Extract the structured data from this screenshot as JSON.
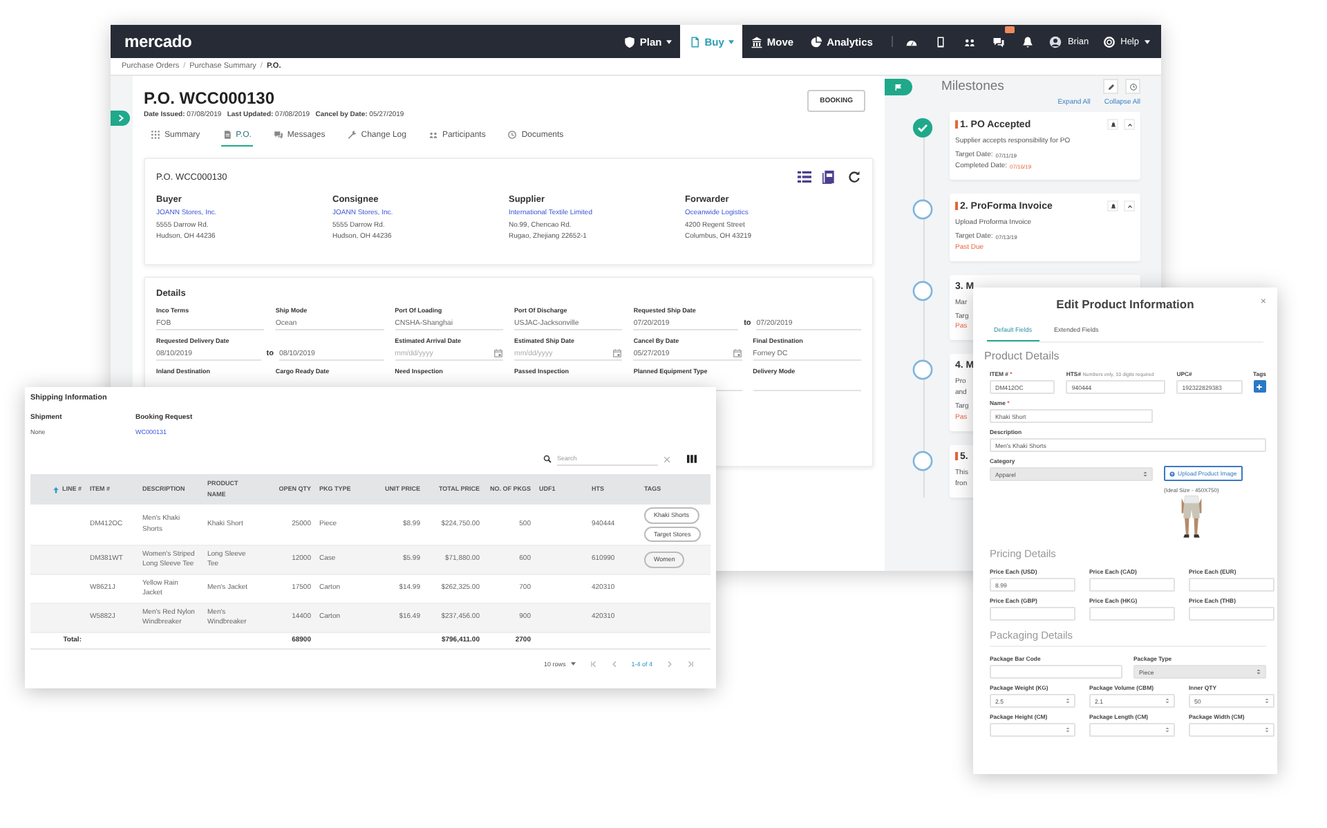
{
  "nav": {
    "logo": "mercado",
    "menus": [
      {
        "label": "Plan",
        "dropdown": true,
        "selected": false
      },
      {
        "label": "Buy",
        "dropdown": true,
        "selected": true
      },
      {
        "label": "Move",
        "dropdown": false,
        "selected": false
      },
      {
        "label": "Analytics",
        "dropdown": false,
        "selected": false
      }
    ],
    "tools": [
      {
        "badge": false
      },
      {
        "badge": false
      },
      {
        "badge": false
      },
      {
        "badge": true
      },
      {
        "badge": false
      }
    ],
    "user": "Brian",
    "help": {
      "label": "Help",
      "dropdown": true
    }
  },
  "breadcrumb": {
    "items": [
      "Purchase Orders",
      "Purchase Summary",
      "P.O."
    ],
    "separator": "/"
  },
  "header": {
    "title": "P.O. WCC000130",
    "meta": "**Date Issued:** 07/08/2019   **Last Updated:** 07/08/2019   **Cancel by Date:** 05/27/2019",
    "button": "BOOKING"
  },
  "tabs": [
    {
      "label": "Summary",
      "selected": false
    },
    {
      "label": "P.O.",
      "selected": true
    },
    {
      "label": "Messages",
      "selected": false
    },
    {
      "label": "Change Log",
      "selected": false
    },
    {
      "label": "Participants",
      "selected": false
    },
    {
      "label": "Documents",
      "selected": false
    }
  ],
  "po_card": {
    "title": "P.O. WCC000130",
    "parties": [
      {
        "role": "Buyer",
        "name": "JOANN Stores, Inc.",
        "address": [
          "5555 Darrow Rd.",
          "Hudson, OH 44236"
        ]
      },
      {
        "role": "Consignee",
        "name": "JOANN Stores, Inc.",
        "address": [
          "5555 Darrow Rd.",
          "Hudson, OH 44236"
        ]
      },
      {
        "role": "Supplier",
        "name": "International Textile Limited",
        "address": [
          "No.99, Chencao Rd.",
          "Rugao, Zhejiang 22652-1"
        ]
      },
      {
        "role": "Forwarder",
        "name": "Oceanwide Logistics",
        "address": [
          "4200 Regent Street",
          "Columbus, OH 43219"
        ]
      }
    ]
  },
  "details": {
    "title": "Details",
    "fields": [
      {
        "label": "Inco Terms",
        "kind": "text",
        "value": "FOB"
      },
      {
        "label": "Ship Mode",
        "kind": "text",
        "value": "Ocean"
      },
      {
        "label": "Port Of Loading",
        "kind": "text",
        "value": "CNSHA-Shanghai"
      },
      {
        "label": "Port Of Discharge",
        "kind": "text",
        "value": "USJAC-Jacksonville"
      },
      {
        "label": "Requested Ship Date",
        "kind": "range",
        "value": "07/20/2019",
        "separator": "to",
        "value_to": "07/20/2019"
      },
      {
        "label": "Requested Delivery Date",
        "kind": "range",
        "value": "08/10/2019",
        "separator": "to",
        "value_to": "08/10/2019"
      },
      {
        "label": "Estimated Arrival Date",
        "kind": "date",
        "placeholder": "mm/dd/yyyy"
      },
      {
        "label": "Estimated Ship Date",
        "kind": "date",
        "placeholder": "mm/dd/yyyy"
      },
      {
        "label": "Cancel By Date",
        "kind": "date",
        "value": "05/27/2019"
      },
      {
        "label": "Final Destination",
        "kind": "text",
        "value": "Forney DC"
      },
      {
        "label": "Inland Destination",
        "kind": "text"
      },
      {
        "label": "Cargo Ready Date",
        "kind": "text"
      },
      {
        "label": "Need Inspection",
        "kind": "text"
      },
      {
        "label": "Passed Inspection",
        "kind": "text"
      },
      {
        "label": "Planned Equipment Type",
        "kind": "text"
      },
      {
        "label": "Delivery Mode",
        "kind": "text"
      }
    ]
  },
  "milestones": {
    "title": "Milestones",
    "expand_all": "Expand All",
    "collapse_all": "Collapse All",
    "steps": [
      {
        "done": true,
        "flagged": true,
        "expanded": true,
        "title": "1. PO Accepted",
        "description": [
          "Supplier accepts responsibility for PO"
        ],
        "lines": [
          {
            "label": "Target Date:",
            "value": "07/11/19",
            "alert": false
          },
          {
            "label": "Completed Date:",
            "value": "07/16/19",
            "alert": true
          }
        ]
      },
      {
        "done": false,
        "flagged": true,
        "expanded": true,
        "title": "2. ProForma Invoice",
        "description": [
          "Upload Proforma Invoice"
        ],
        "lines": [
          {
            "label": "Target Date:",
            "value": "07/13/19",
            "alert": false
          }
        ],
        "status": "Past Due"
      },
      {
        "done": false,
        "flagged": false,
        "title": "3. M",
        "description": [
          "Mar"
        ],
        "lines": [
          {
            "label": "Targ"
          }
        ],
        "status": "Pas"
      },
      {
        "done": false,
        "flagged": false,
        "title": "4. M",
        "description": [
          "Pro",
          "and"
        ],
        "lines": [
          {
            "label": "Targ"
          }
        ],
        "status": "Pas"
      },
      {
        "done": false,
        "flagged": true,
        "title": "5.",
        "description": [
          "This",
          "fron"
        ]
      }
    ]
  },
  "shipping": {
    "title": "Shipping Information",
    "shipment": {
      "label": "Shipment",
      "value": "None"
    },
    "booking": {
      "label": "Booking Request",
      "value": "WC000131"
    },
    "search": {
      "placeholder": "Search"
    },
    "columns": [
      {
        "label": "LINE #",
        "sorted": true
      },
      {
        "label": "ITEM #",
        "sorted": false
      },
      {
        "label": "DESCRIPTION",
        "sorted": false
      },
      {
        "label": "PRODUCT NAME",
        "sorted": false
      },
      {
        "label": "OPEN QTY",
        "sorted": false
      },
      {
        "label": "PKG TYPE",
        "sorted": false
      },
      {
        "label": "UNIT PRICE",
        "sorted": false
      },
      {
        "label": "TOTAL PRICE",
        "sorted": false
      },
      {
        "label": "NO. OF PKGS",
        "sorted": false
      },
      {
        "label": "UDF1",
        "sorted": false
      },
      {
        "label": "HTS",
        "sorted": false
      },
      {
        "label": "TAGS",
        "sorted": false
      }
    ],
    "rows": [
      {
        "cells": [
          "",
          "DM412OC",
          "Men's Khaki Shorts",
          "Khaki Short",
          "25000",
          "Piece",
          "$8.99",
          "$224,750.00",
          "500",
          "",
          "940444"
        ],
        "tags": [
          "Khaki Shorts",
          "Target Stores"
        ]
      },
      {
        "cells": [
          "",
          "DM381WT",
          "Women's Striped Long Sleeve Tee",
          "Long Sleeve Tee",
          "12000",
          "Case",
          "$5.99",
          "$71,880.00",
          "600",
          "",
          "610990"
        ],
        "tags": [
          "Women"
        ]
      },
      {
        "cells": [
          "",
          "W8621J",
          "Yellow Rain Jacket",
          "Men's Jacket",
          "17500",
          "Carton",
          "$14.99",
          "$262,325.00",
          "700",
          "",
          "420310"
        ],
        "tags": []
      },
      {
        "cells": [
          "",
          "W5882J",
          "Men's Red Nylon Windbreaker",
          "Men's Windbreaker",
          "14400",
          "Carton",
          "$16.49",
          "$237,456.00",
          "900",
          "",
          "420310"
        ],
        "tags": []
      }
    ],
    "total": {
      "label": "Total:",
      "open_qty": "68900",
      "total_price": "$796,411.00",
      "pkgs": "2700"
    },
    "pager": {
      "rows": "10 rows",
      "range": "1-4 of 4"
    }
  },
  "modal": {
    "title": "Edit Product Information",
    "close": "×",
    "tabs": [
      {
        "label": "Default Fields",
        "selected": true
      },
      {
        "label": "Extended Fields",
        "selected": false
      }
    ],
    "product": {
      "heading": "Product Details",
      "item": {
        "label": "ITEM #",
        "required_mark": "*",
        "value": "DM412OC"
      },
      "hts": {
        "label": "HTS#",
        "hint": "Numbers only, 10 digits required",
        "value": "940444"
      },
      "upc": {
        "label": "UPC#",
        "value": "192322829383"
      },
      "tags": {
        "label": "Tags"
      },
      "name": {
        "label": "Name",
        "required_mark": "*",
        "value": "Khaki Short"
      },
      "description": {
        "label": "Description",
        "value": "Men's Khaki Shorts"
      },
      "category": {
        "label": "Category",
        "value": "Apparel"
      },
      "upload": "Upload Product Image",
      "image_caption": "(Ideal Size - 450X750)"
    },
    "pricing": {
      "heading": "Pricing Details",
      "fields": [
        {
          "label": "Price Each (USD)",
          "value": "8.99"
        },
        {
          "label": "Price Each (CAD)"
        },
        {
          "label": "Price Each (EUR)"
        },
        {
          "label": "Price Each (GBP)"
        },
        {
          "label": "Price Each (HKG)"
        },
        {
          "label": "Price Each (THB)"
        }
      ]
    },
    "packaging": {
      "heading": "Packaging Details",
      "bar_code": {
        "label": "Package Bar Code"
      },
      "type": {
        "label": "Package Type",
        "value": "Piece"
      },
      "fields": [
        {
          "label": "Package Weight (KG)",
          "value": "2.5"
        },
        {
          "label": "Package Volume (CBM)",
          "value": "2.1"
        },
        {
          "label": "Inner QTY",
          "value": "50"
        },
        {
          "label": "Package Height (CM)"
        },
        {
          "label": "Package Length (CM)"
        },
        {
          "label": "Package Width (CM)"
        }
      ]
    }
  }
}
